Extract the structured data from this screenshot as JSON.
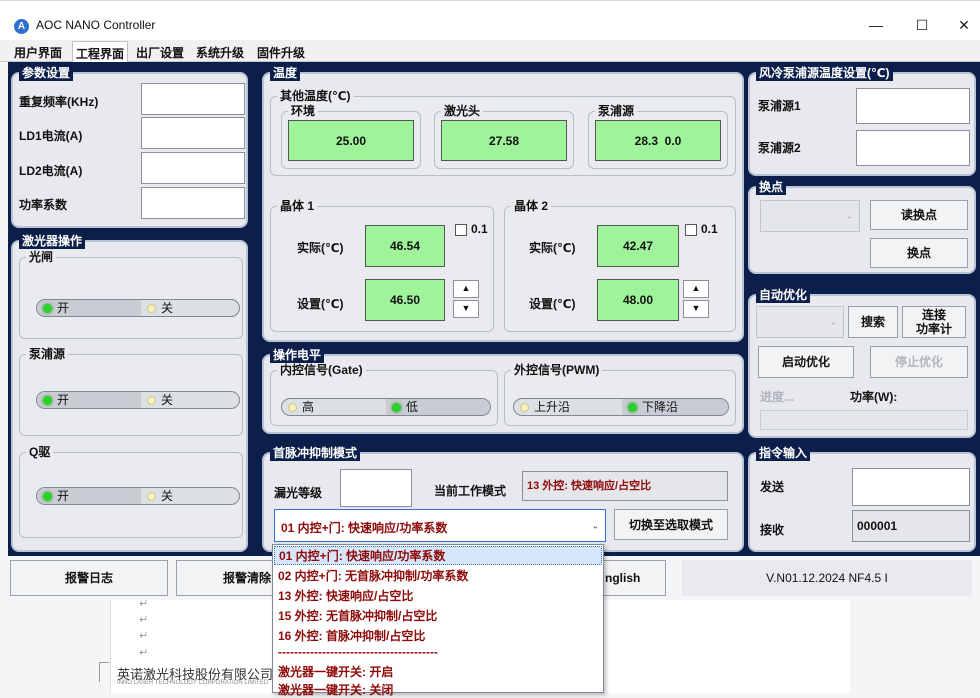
{
  "window": {
    "title": "AOC NANO Controller",
    "minimize": "—",
    "maximize": "☐",
    "close": "✕",
    "icon_letter": "A"
  },
  "menu": [
    "用户界面",
    "工程界面",
    "出厂设置",
    "系统升级",
    "固件升级"
  ],
  "params": {
    "title": "参数设置",
    "fields": [
      "重复频率(KHz)",
      "LD1电流(A)",
      "LD2电流(A)",
      "功率系数"
    ]
  },
  "laser_ops": {
    "title": "激光器操作",
    "groups": [
      {
        "title": "光闸",
        "on": "开",
        "off": "关"
      },
      {
        "title": "泵浦源",
        "on": "开",
        "off": "关"
      },
      {
        "title": "Q驱",
        "on": "开",
        "off": "关"
      }
    ]
  },
  "temperature": {
    "title": "温度",
    "other": {
      "title": "其他温度(℃)",
      "items": [
        {
          "label": "环境",
          "value": "25.00"
        },
        {
          "label": "激光头",
          "value": "27.58"
        },
        {
          "label": "泵浦源",
          "value": "28.3  0.0"
        }
      ]
    },
    "crystals": [
      {
        "title": "晶体 1",
        "actual_label": "实际(℃)",
        "actual": "46.54",
        "set_label": "设置(℃)",
        "set": "46.50",
        "step": "0.1"
      },
      {
        "title": "晶体 2",
        "actual_label": "实际(℃)",
        "actual": "42.47",
        "set_label": "设置(℃)",
        "set": "48.00",
        "step": "0.1"
      }
    ],
    "spin_up": "▲",
    "spin_down": "▼"
  },
  "level": {
    "title": "操作电平",
    "internal": {
      "title": "内控信号(Gate)",
      "a": "高",
      "b": "低"
    },
    "external": {
      "title": "外控信号(PWM)",
      "a": "上升沿",
      "b": "下降沿"
    }
  },
  "first_pulse": {
    "title": "首脉冲抑制模式",
    "leak_label": "漏光等级",
    "mode_label": "当前工作模式",
    "mode_value": "13 外控: 快速响应/占空比",
    "selected": "01 内控+门: 快速响应/功率系数",
    "switch_button": "切换至选取模式",
    "caret": "⌄"
  },
  "cool": {
    "title": "风冷泵浦源温度设置(℃)",
    "fields": [
      "泵浦源1",
      "泵浦源2"
    ]
  },
  "swap": {
    "title": "换点",
    "read_button": "读换点",
    "swap_button": "换点"
  },
  "auto": {
    "title": "自动优化",
    "search": "搜索",
    "connect": "连接\n功率计",
    "start": "启动优化",
    "stop": "停止优化",
    "progress": "进度...",
    "power": "功率(W):"
  },
  "cmd": {
    "title": "指令输入",
    "send": "发送",
    "recv": "接收",
    "recv_value": "000001"
  },
  "bottom": {
    "alarm_log": "报警日志",
    "alarm_clear": "报警清除",
    "lang": "nglish",
    "version": "V.N01.12.2024 NF4.5 I"
  },
  "document": {
    "company": "英诺激光科技股份有限公司",
    "company_en": "INNO LASER TECHNOLOGY CORPORATION LIMITED",
    "return_mark": "↵"
  },
  "dropdown": [
    "01 内控+门: 快速响应/功率系数",
    "02 内控+门: 无首脉冲抑制/功率系数",
    "13 外控: 快速响应/占空比",
    "15 外控: 无首脉冲抑制/占空比",
    "16 外控: 首脉冲抑制/占空比",
    "----------------------------------------",
    "激光器一键开关: 开启",
    "激光器一键开关: 关闭"
  ]
}
